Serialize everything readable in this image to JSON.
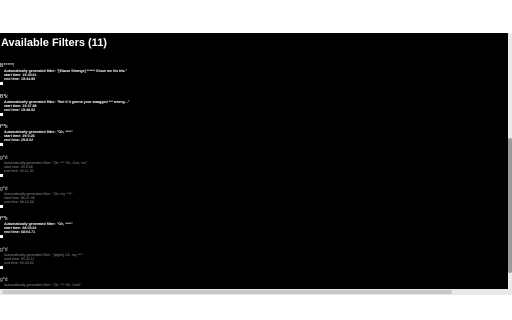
{
  "page": {
    "title": "Available Filters (11)"
  },
  "filters": [
    {
      "name": "B*****!",
      "meta": [
        "Automatically generated filter: \"[Elazar Strange] ****** Show me his tits.\"",
        "start time: 15:45.61",
        "end time: 15:44.89"
      ],
      "active": true
    },
    {
      "name": "B*k",
      "meta": [
        "Automatically generated filter: \"But if it gonna your swagged *** wrong...\"",
        "start time: 15:37.88",
        "end time: 15:48.92"
      ],
      "active": true
    },
    {
      "name": "f**k",
      "meta": [
        "Automatically generated filter: \"Oh, ****\"",
        "start time: 29:0.28",
        "end time: 29:8.02"
      ],
      "active": true
    },
    {
      "name": "g*d",
      "meta": [
        "Automatically generated filter: \"Oh, *** Oh, God, no!\"",
        "start time: 29:0.68",
        "end time: 29:11.35"
      ],
      "active": false
    },
    {
      "name": "g*d",
      "meta": [
        "Automatically generated filter: \"Oh, my ***!\"",
        "start time: 66:21.98",
        "end time: 66:22.86"
      ],
      "active": false
    },
    {
      "name": "f**k",
      "meta": [
        "Automatically generated filter: \"Oh, ****\"",
        "start time: 68:03.62",
        "end time: 68:04.71"
      ],
      "active": true
    },
    {
      "name": "g*d",
      "meta": [
        "Automatically generated filter: \"[sighs] Oh, my ***\"",
        "start time: 90:42.11",
        "end time: 90:43.62"
      ],
      "active": false
    },
    {
      "name": "g*d",
      "meta": [
        "Automatically generated filter: \"Oh, *** Oh, God!\""
      ],
      "active": false
    }
  ]
}
